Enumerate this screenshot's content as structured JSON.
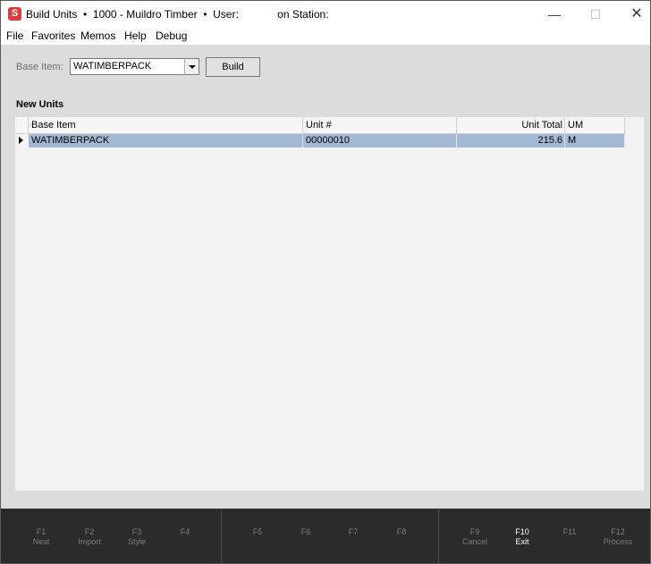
{
  "window": {
    "app_icon": "S",
    "title": "Build Units  •  1000 - Muildro Timber  •  User:             on Station:",
    "controls": {
      "minimize": "—",
      "maximize": "☐",
      "close": "✕"
    }
  },
  "menu": [
    "File",
    "Favorites",
    "Memos",
    "Help",
    "Debug"
  ],
  "form": {
    "base_item_label": "Base Item:",
    "base_item_value": "WATIMBERPACK",
    "build_button": "Build"
  },
  "section_title": "New Units",
  "grid": {
    "columns": [
      "Base Item",
      "Unit #",
      "Unit Total",
      "UM"
    ],
    "rows": [
      {
        "base_item": "WATIMBERPACK",
        "unit_no": "00000010",
        "unit_total": "215.6",
        "um": "M"
      }
    ]
  },
  "fkeys": [
    {
      "key": "F1",
      "label": "Next",
      "active": false
    },
    {
      "key": "F2",
      "label": "Import",
      "active": false
    },
    {
      "key": "F3",
      "label": "Style",
      "active": false
    },
    {
      "key": "F4",
      "label": "",
      "active": false
    },
    {
      "key": "F5",
      "label": "",
      "active": false
    },
    {
      "key": "F6",
      "label": "",
      "active": false
    },
    {
      "key": "F7",
      "label": "",
      "active": false
    },
    {
      "key": "F8",
      "label": "",
      "active": false
    },
    {
      "key": "F9",
      "label": "Cancel",
      "active": false
    },
    {
      "key": "F10",
      "label": "Exit",
      "active": true
    },
    {
      "key": "F11",
      "label": "",
      "active": false
    },
    {
      "key": "F12",
      "label": "Process",
      "active": false
    }
  ],
  "colors": {
    "selected_row": "#a2b8d3",
    "footer_bg": "#2b2b2b",
    "content_bg": "#dcdcdc",
    "app_icon": "#e03a3a"
  }
}
